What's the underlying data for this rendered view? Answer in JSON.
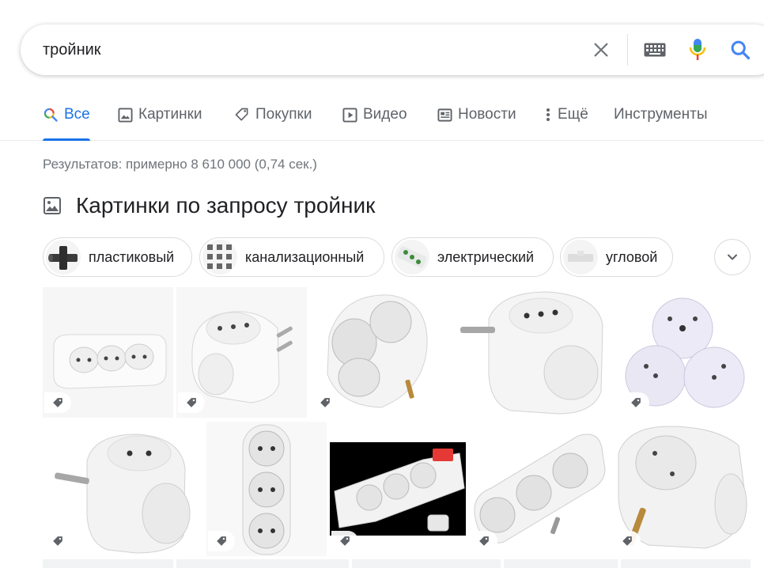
{
  "search": {
    "query": "тройник"
  },
  "tabs": [
    {
      "label": "Все",
      "icon": "search-icon"
    },
    {
      "label": "Картинки",
      "icon": "image-icon"
    },
    {
      "label": "Покупки",
      "icon": "tag-icon"
    },
    {
      "label": "Видео",
      "icon": "play-icon"
    },
    {
      "label": "Новости",
      "icon": "news-icon"
    },
    {
      "label": "Ещё",
      "icon": "more-vert-icon"
    },
    {
      "label": "Инструменты",
      "icon": ""
    }
  ],
  "result_stats": "Результатов: примерно 8 610 000 (0,74 сек.)",
  "images_section": {
    "title": "Картинки по запросу тройник"
  },
  "chips": [
    {
      "label": "пластиковый"
    },
    {
      "label": "канализационный"
    },
    {
      "label": "электрический"
    },
    {
      "label": "угловой"
    }
  ],
  "colors": {
    "accent": "#1a73e8",
    "tab_text": "#5f6368",
    "stats_text": "#70757a",
    "red_switch": "#e53935"
  }
}
